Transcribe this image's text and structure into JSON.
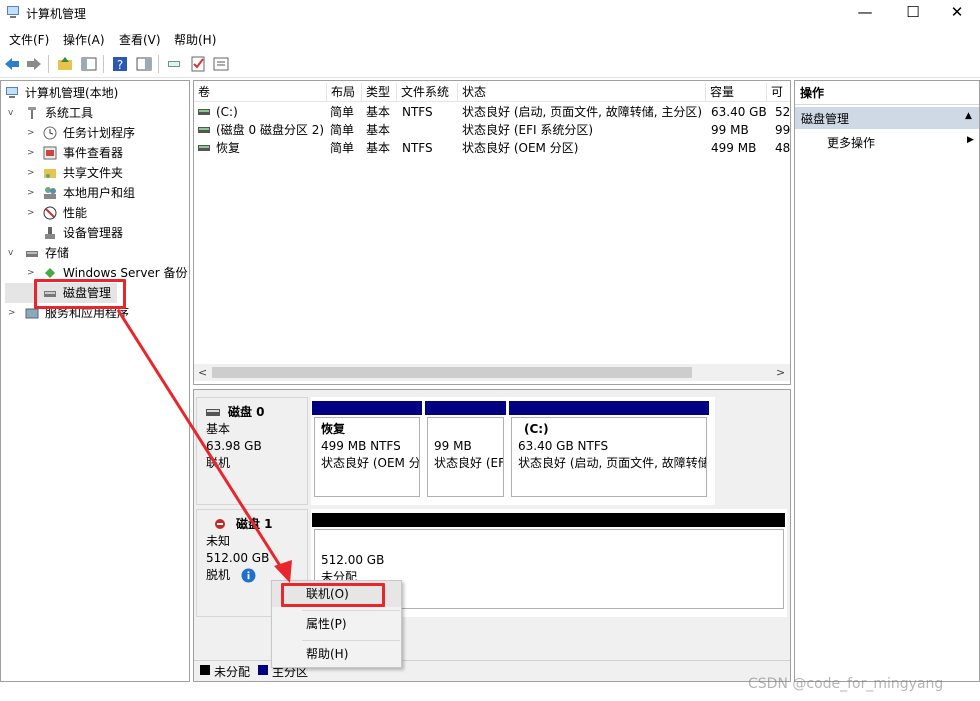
{
  "window": {
    "title": "计算机管理",
    "controls": {
      "minimize": "—",
      "maximize": "☐",
      "close": "✕"
    }
  },
  "menu": [
    "文件(F)",
    "操作(A)",
    "查看(V)",
    "帮助(H)"
  ],
  "tree": {
    "root": "计算机管理(本地)",
    "system_tools": "系统工具",
    "task_scheduler": "任务计划程序",
    "event_viewer": "事件查看器",
    "shared_folders": "共享文件夹",
    "local_users": "本地用户和组",
    "performance": "性能",
    "device_manager": "设备管理器",
    "storage": "存储",
    "windows_backup": "Windows Server 备份",
    "disk_management": "磁盘管理",
    "services_apps": "服务和应用程序"
  },
  "volume_table": {
    "headers": [
      "卷",
      "布局",
      "类型",
      "文件系统",
      "状态",
      "容量",
      "可"
    ],
    "rows": [
      {
        "volume": "(C:)",
        "layout": "简单",
        "type": "基本",
        "fs": "NTFS",
        "status": "状态良好 (启动, 页面文件, 故障转储, 主分区)",
        "capacity": "63.40 GB",
        "free": "52"
      },
      {
        "volume": "(磁盘 0 磁盘分区 2)",
        "layout": "简单",
        "type": "基本",
        "fs": "",
        "status": "状态良好 (EFI 系统分区)",
        "capacity": "99 MB",
        "free": "99"
      },
      {
        "volume": "恢复",
        "layout": "简单",
        "type": "基本",
        "fs": "NTFS",
        "status": "状态良好 (OEM 分区)",
        "capacity": "499 MB",
        "free": "48"
      }
    ]
  },
  "disk0": {
    "name": "磁盘 0",
    "type": "基本",
    "size": "63.98 GB",
    "status": "联机",
    "partitions": [
      {
        "name": "恢复",
        "size": "499 MB NTFS",
        "status": "状态良好 (OEM 分"
      },
      {
        "name": "",
        "size": "99 MB",
        "status": "状态良好 (EF"
      },
      {
        "name": "(C:)",
        "size": "63.40 GB NTFS",
        "status": "状态良好 (启动, 页面文件, 故障转储"
      }
    ]
  },
  "disk1": {
    "name": "磁盘 1",
    "type": "未知",
    "size": "512.00 GB",
    "status": "脱机",
    "partition_size": "512.00 GB",
    "partition_status": "未分配"
  },
  "context_menu": [
    "联机(O)",
    "属性(P)",
    "帮助(H)"
  ],
  "legend": [
    "未分配",
    "主分区"
  ],
  "actions": {
    "header": "操作",
    "section": "磁盘管理",
    "more": "更多操作"
  },
  "watermark": "CSDN @code_for_mingyang",
  "colors": {
    "primary_partition": "#000080",
    "unallocated": "#000000",
    "highlight": "#e8262c"
  }
}
